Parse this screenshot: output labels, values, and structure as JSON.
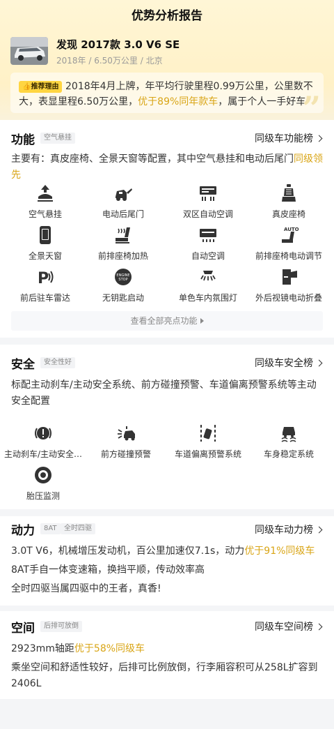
{
  "header": {
    "title": "优势分析报告"
  },
  "car": {
    "name": "发现 2017款 3.0 V6 SE",
    "meta": "2018年 / 6.50万公里 / 北京"
  },
  "reason": {
    "tag": "推荐理由",
    "text_a": "2018年4月上牌，年平均行驶里程0.99万公里，公里数不大，表显里程6.50万公里，",
    "text_hl": "优于89%同年款车",
    "text_b": "，属于个人一手好车"
  },
  "features": {
    "title": "功能",
    "tag": "空气悬挂",
    "rank": "同级车功能榜",
    "desc_a": "主要有：真皮座椅、全景天窗等配置，其中空气悬挂和电动后尾门",
    "desc_hl": "同级领先",
    "items": [
      {
        "label": "空气悬挂",
        "icon": "air-suspension-icon"
      },
      {
        "label": "电动后尾门",
        "icon": "power-tailgate-icon"
      },
      {
        "label": "双区自动空调",
        "icon": "dual-zone-ac-icon"
      },
      {
        "label": "真皮座椅",
        "icon": "leather-seat-icon"
      },
      {
        "label": "全景天窗",
        "icon": "panoramic-sunroof-icon"
      },
      {
        "label": "前排座椅加热",
        "icon": "seat-heating-icon"
      },
      {
        "label": "自动空调",
        "icon": "auto-ac-icon"
      },
      {
        "label": "前排座椅电动调节",
        "icon": "power-seat-icon"
      },
      {
        "label": "前后驻车雷达",
        "icon": "parking-radar-icon"
      },
      {
        "label": "无钥匙启动",
        "icon": "keyless-start-icon"
      },
      {
        "label": "单色车内氛围灯",
        "icon": "ambient-light-icon"
      },
      {
        "label": "外后视镜电动折叠",
        "icon": "mirror-fold-icon"
      }
    ],
    "view_all": "查看全部亮点功能"
  },
  "safety": {
    "title": "安全",
    "tag": "安全性好",
    "rank": "同级车安全榜",
    "desc": "标配主动刹车/主动安全系统、前方碰撞预警、车道偏离预警系统等主动安全配置",
    "items": [
      {
        "label": "主动刹车/主动安全…",
        "icon": "active-brake-icon"
      },
      {
        "label": "前方碰撞预警",
        "icon": "collision-warning-icon"
      },
      {
        "label": "车道偏离预警系统",
        "icon": "lane-departure-icon"
      },
      {
        "label": "车身稳定系统",
        "icon": "stability-control-icon"
      },
      {
        "label": "胎压监测",
        "icon": "tire-pressure-icon"
      }
    ]
  },
  "power": {
    "title": "动力",
    "tags": [
      "8AT",
      "全时四驱"
    ],
    "rank": "同级车动力榜",
    "line1_a": "3.0T V6，机械增压发动机，百公里加速仅7.1s，动力",
    "line1_hl": "优于91%同级车",
    "line2": "8AT手自一体变速箱，换挡平顺，传动效率高",
    "line3": "全时四驱当属四驱中的王者，真香!"
  },
  "space": {
    "title": "空间",
    "tag": "后排可放倒",
    "rank": "同级车空间榜",
    "line1_a": "2923mm轴距",
    "line1_hl": "优于58%同级车",
    "line2": "乘坐空间和舒适性较好，后排可比例放倒，行李厢容积可从258L扩容到2406L"
  },
  "colors": {
    "accent": "#d9a516",
    "tag_bg": "#ffd541",
    "header_bg": "#fff3cc"
  }
}
